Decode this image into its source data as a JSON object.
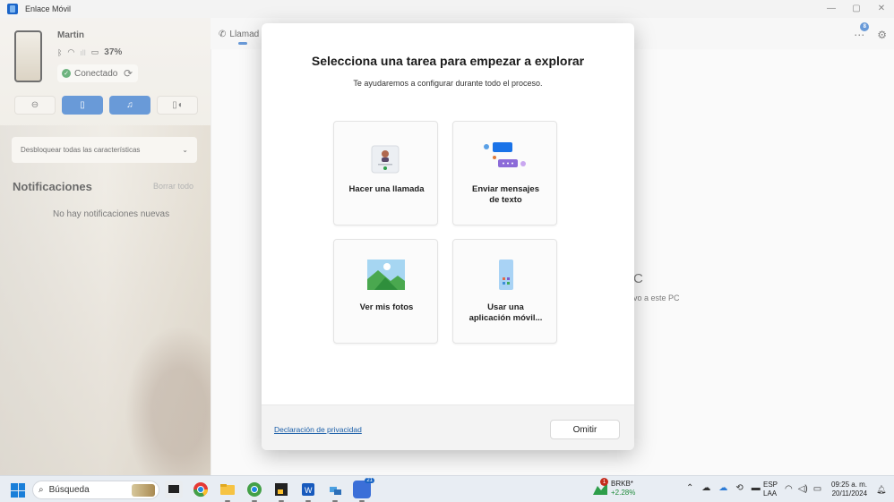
{
  "app": {
    "title": "Enlace Móvil"
  },
  "sidebar": {
    "device_name": "Martin",
    "battery": "37%",
    "connection_status": "Conectado",
    "unlock_label": "Desbloquear todas las características",
    "notifications_title": "Notificaciones",
    "clear_all": "Borrar todo",
    "empty_message": "No hay notificaciones nuevas"
  },
  "main": {
    "tab_calls": "Llamad",
    "notification_count": "8",
    "background_heading": "C",
    "background_text": "vo a este PC"
  },
  "dialog": {
    "title": "Selecciona una tarea para empezar a explorar",
    "subtitle": "Te ayudaremos a configurar durante todo el proceso.",
    "cards": [
      {
        "label": "Hacer una llamada"
      },
      {
        "label_line1": "Enviar mensajes",
        "label_line2": "de texto"
      },
      {
        "label": "Ver mis fotos"
      },
      {
        "label_line1": "Usar una",
        "label_line2": "aplicación móvil..."
      }
    ],
    "privacy_link": "Declaración de privacidad",
    "skip_button": "Omitir"
  },
  "taskbar": {
    "search_placeholder": "Búsqueda",
    "teams_badge": "21",
    "stock_badge": "1",
    "stock_name": "BRKB*",
    "stock_change": "+2.28%",
    "lang_line1": "ESP",
    "lang_line2": "LAA",
    "time": "09:25 a. m.",
    "date": "20/11/2024"
  },
  "colors": {
    "accent": "#1965c4",
    "connected": "#1f8b3a",
    "link": "#1a5ea8"
  }
}
